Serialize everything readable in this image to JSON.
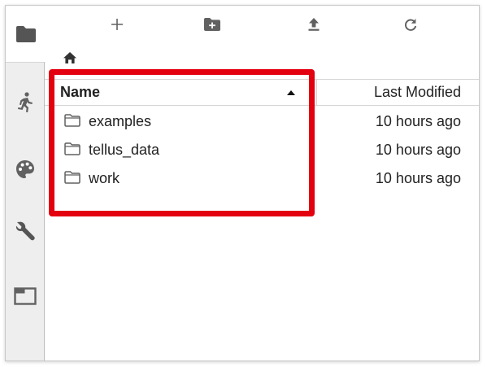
{
  "toolbar": {
    "new_launcher_icon": "plus-icon",
    "new_folder_icon": "folder-plus-icon",
    "upload_icon": "upload-icon",
    "refresh_icon": "refresh-icon"
  },
  "breadcrumb": {
    "home_icon": "home-icon"
  },
  "sidebar": {
    "items": [
      {
        "icon": "folder-icon",
        "active": true
      },
      {
        "icon": "running-icon"
      },
      {
        "icon": "palette-icon"
      },
      {
        "icon": "wrench-icon"
      },
      {
        "icon": "tab-icon"
      }
    ]
  },
  "file_list": {
    "columns": {
      "name": "Name",
      "last_modified": "Last Modified"
    },
    "sort": "ascending",
    "rows": [
      {
        "name": "examples",
        "modified": "10 hours ago"
      },
      {
        "name": "tellus_data",
        "modified": "10 hours ago"
      },
      {
        "name": "work",
        "modified": "10 hours ago"
      }
    ]
  },
  "colors": {
    "highlight": "#e3000f",
    "icon": "#616161",
    "sidebar_bg": "#eeeeee"
  }
}
